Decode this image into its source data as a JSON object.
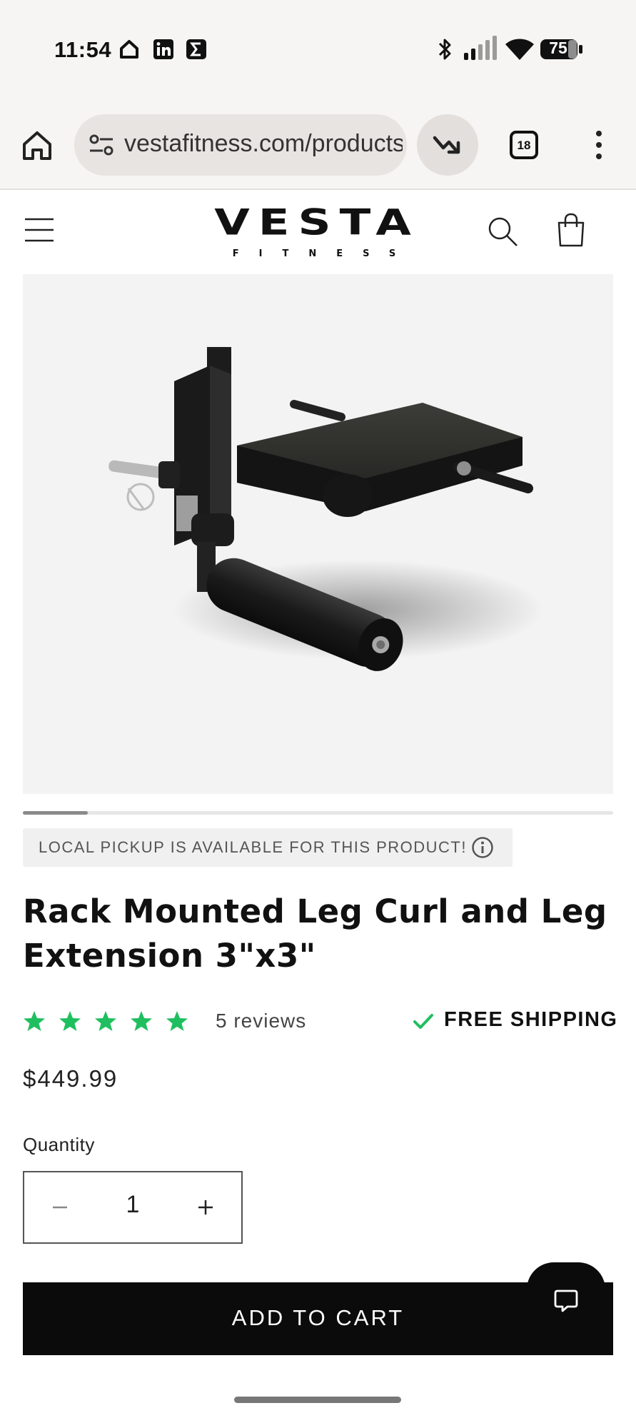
{
  "status_bar": {
    "time": "11:54",
    "battery": "75",
    "left_icons": [
      "home-icon",
      "linkedin-icon",
      "sigma-icon"
    ],
    "right_icons": [
      "bluetooth-icon",
      "signal-icon",
      "wifi-icon",
      "battery-icon"
    ]
  },
  "browser": {
    "url": "vestafitness.com/products/rack-mounted-leg-curl",
    "tab_count": "18"
  },
  "site_header": {
    "logo_main": "VESTA",
    "logo_sub": "FITNESS"
  },
  "product": {
    "pickup_notice": "LOCAL PICKUP IS AVAILABLE FOR THIS PRODUCT!",
    "title": "Rack Mounted Leg Curl and Leg Extension 3\"x3\"",
    "rating_stars": 5,
    "reviews_label": "5 reviews",
    "shipping_label": "FREE SHIPPING",
    "price": "$449.99",
    "quantity_label": "Quantity",
    "quantity_value": "1",
    "add_to_cart_label": "ADD TO CART",
    "gallery_progress": 0.11
  },
  "colors": {
    "star": "#1fbf5f",
    "check": "#1fbf5f",
    "button": "#0b0b0b",
    "status_bg": "#f7f5f3"
  }
}
